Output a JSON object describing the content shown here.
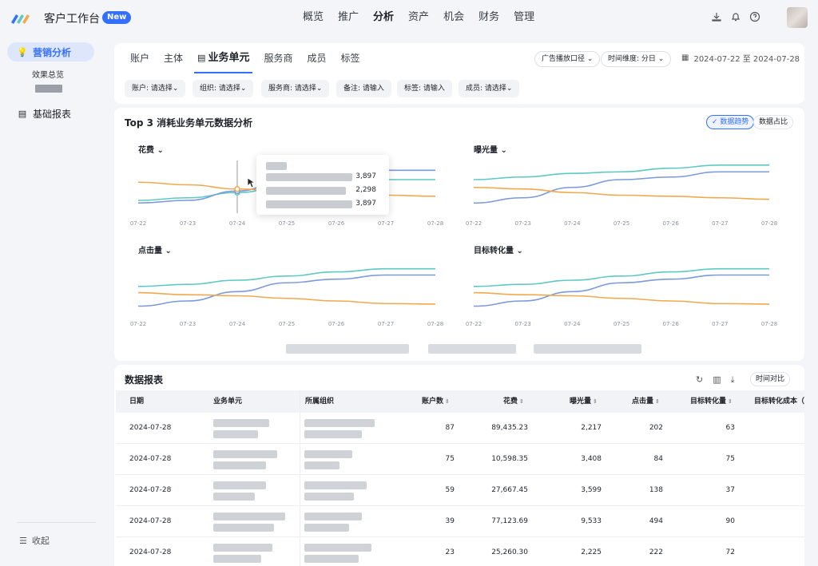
{
  "app": {
    "title": "客户工作台",
    "badge": "New"
  },
  "topnav": [
    "概览",
    "推广",
    "分析",
    "资产",
    "机会",
    "财务",
    "管理"
  ],
  "topnav_active": 2,
  "sidebar": {
    "items": [
      {
        "label": "营销分析",
        "active": true
      },
      {
        "label": "基础报表",
        "active": false
      }
    ],
    "sub": "效果总览",
    "collapse": "收起"
  },
  "tabs": [
    "账户",
    "主体",
    "业务单元",
    "服务商",
    "成员",
    "标签"
  ],
  "tabs_active": 2,
  "toolbar": {
    "ad_scope": "广告播放口径",
    "time_dim": "时间维度: 分日",
    "date_range": "2024-07-22 至 2024-07-28"
  },
  "filters": [
    "账户: 请选择",
    "组织: 请选择",
    "服务商: 请选择",
    "备注: 请输入",
    "标签: 请输入",
    "成员: 请选择"
  ],
  "chart_section": {
    "title": "Top 3 消耗业务单元数据分析",
    "toggle_on": "数据趋势",
    "toggle_off": "数据占比"
  },
  "chart_data": [
    {
      "type": "line",
      "title": "花费",
      "x": [
        "07-22",
        "07-23",
        "07-24",
        "07-25",
        "07-26",
        "07-27",
        "07-28"
      ],
      "series": [
        {
          "color": "#5ec9c4",
          "values": [
            0.2,
            0.25,
            0.35,
            0.48,
            0.58,
            0.6,
            0.6
          ]
        },
        {
          "color": "#7b99dd",
          "values": [
            0.15,
            0.2,
            0.38,
            0.6,
            0.72,
            0.78,
            0.78
          ]
        },
        {
          "color": "#f0a94e",
          "values": [
            0.55,
            0.5,
            0.42,
            0.38,
            0.34,
            0.3,
            0.28
          ]
        }
      ]
    },
    {
      "type": "line",
      "title": "曝光量",
      "x": [
        "07-22",
        "07-23",
        "07-24",
        "07-25",
        "07-26",
        "07-27",
        "07-28"
      ],
      "series": [
        {
          "color": "#5ec9c4",
          "values": [
            0.6,
            0.65,
            0.72,
            0.75,
            0.82,
            0.88,
            0.88
          ]
        },
        {
          "color": "#7b99dd",
          "values": [
            0.15,
            0.25,
            0.45,
            0.6,
            0.65,
            0.75,
            0.75
          ]
        },
        {
          "color": "#f0a94e",
          "values": [
            0.45,
            0.42,
            0.35,
            0.3,
            0.28,
            0.25,
            0.22
          ]
        }
      ]
    },
    {
      "type": "line",
      "title": "点击量",
      "x": [
        "07-22",
        "07-23",
        "07-24",
        "07-25",
        "07-26",
        "07-27",
        "07-28"
      ],
      "series": [
        {
          "color": "#5ec9c4",
          "values": [
            0.48,
            0.52,
            0.6,
            0.68,
            0.76,
            0.82,
            0.82
          ]
        },
        {
          "color": "#7b99dd",
          "values": [
            0.1,
            0.2,
            0.38,
            0.55,
            0.62,
            0.7,
            0.7
          ]
        },
        {
          "color": "#f0a94e",
          "values": [
            0.36,
            0.32,
            0.3,
            0.25,
            0.2,
            0.15,
            0.14
          ]
        }
      ]
    },
    {
      "type": "line",
      "title": "目标转化量",
      "x": [
        "07-22",
        "07-23",
        "07-24",
        "07-25",
        "07-26",
        "07-27",
        "07-28"
      ],
      "series": [
        {
          "color": "#5ec9c4",
          "values": [
            0.48,
            0.52,
            0.6,
            0.68,
            0.76,
            0.82,
            0.82
          ]
        },
        {
          "color": "#7b99dd",
          "values": [
            0.1,
            0.2,
            0.38,
            0.55,
            0.62,
            0.7,
            0.7
          ]
        },
        {
          "color": "#f0a94e",
          "values": [
            0.36,
            0.32,
            0.3,
            0.25,
            0.2,
            0.15,
            0.14
          ]
        }
      ]
    }
  ],
  "tooltip": {
    "values": [
      "3,897",
      "2,298",
      "3,897"
    ]
  },
  "report": {
    "title": "数据报表",
    "compare": "时间对比",
    "columns": [
      "日期",
      "业务单元",
      "所属组织",
      "账户数",
      "花费",
      "曝光量",
      "点击量",
      "目标转化量",
      "目标转化成本（"
    ],
    "rows": [
      {
        "date": "2024-07-28",
        "accounts": "87",
        "spend": "89,435.23",
        "impressions": "2,217",
        "clicks": "202",
        "conversions": "63"
      },
      {
        "date": "2024-07-28",
        "accounts": "75",
        "spend": "10,598.35",
        "impressions": "3,408",
        "clicks": "84",
        "conversions": "75"
      },
      {
        "date": "2024-07-28",
        "accounts": "59",
        "spend": "27,667.45",
        "impressions": "3,599",
        "clicks": "138",
        "conversions": "37"
      },
      {
        "date": "2024-07-28",
        "accounts": "39",
        "spend": "77,123.69",
        "impressions": "9,533",
        "clicks": "494",
        "conversions": "90"
      },
      {
        "date": "2024-07-28",
        "accounts": "23",
        "spend": "25,260.30",
        "impressions": "2,225",
        "clicks": "222",
        "conversions": "72"
      }
    ]
  }
}
